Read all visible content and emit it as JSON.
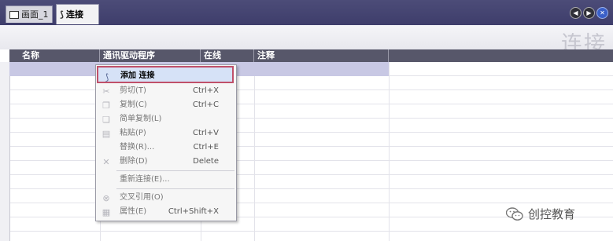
{
  "tabs": [
    {
      "label": "画面_1",
      "icon": "screen-icon"
    },
    {
      "label": "连接",
      "icon": "connection-icon"
    }
  ],
  "nav": {
    "prev_icon": "prev-icon",
    "next_icon": "next-icon",
    "close_icon": "close-icon"
  },
  "editor": {
    "title": "连接"
  },
  "columns": [
    "名称",
    "通讯驱动程序",
    "在线",
    "注释"
  ],
  "context_menu": {
    "items": [
      {
        "label": "添加 连接",
        "shortcut": "",
        "icon": "add-connection-icon",
        "highlighted": true
      },
      {
        "label": "剪切(T)",
        "shortcut": "Ctrl+X",
        "icon": "cut-icon"
      },
      {
        "label": "复制(C)",
        "shortcut": "Ctrl+C",
        "icon": "copy-icon"
      },
      {
        "label": "简单复制(L)",
        "shortcut": "",
        "icon": "simple-copy-icon"
      },
      {
        "label": "粘贴(P)",
        "shortcut": "Ctrl+V",
        "icon": "paste-icon"
      },
      {
        "label": "替换(R)...",
        "shortcut": "Ctrl+E",
        "icon": ""
      },
      {
        "label": "删除(D)",
        "shortcut": "Delete",
        "icon": "delete-icon"
      },
      {
        "label": "重新连接(E)...",
        "shortcut": "",
        "icon": ""
      },
      {
        "label": "交叉引用(O)",
        "shortcut": "",
        "icon": "cross-reference-icon"
      },
      {
        "label": "属性(E)",
        "shortcut": "Ctrl+Shift+X",
        "icon": "properties-icon"
      }
    ]
  },
  "watermark": {
    "text": "创控教育",
    "icon": "wechat-icon"
  },
  "colors": {
    "tabbar": "#3e3d6b",
    "header": "#57576a",
    "selection": "#c8c8e4",
    "highlight_border": "#c0506a"
  }
}
